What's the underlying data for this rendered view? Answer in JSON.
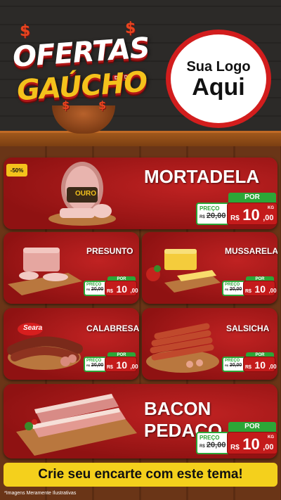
{
  "header": {
    "title_line1": "OFERTAS",
    "title_line2": "GAÚCHO",
    "title_tag": "DIA DO",
    "logo_line1": "Sua Logo",
    "logo_line2": "Aqui"
  },
  "featured": {
    "name": "MORTADELA",
    "badge": "-50%",
    "brand": "OURO",
    "price_label": "PREÇO",
    "old_prefix": "R$",
    "old_price": "20,00",
    "por_label": "POR",
    "currency": "R$",
    "price_int": "10",
    "price_dec": ",00",
    "unit": "KG"
  },
  "products": [
    {
      "name": "PRESUNTO",
      "price_label": "PREÇO",
      "old_prefix": "R$",
      "old_price": "20,00",
      "por_label": "POR",
      "currency": "R$",
      "price_int": "10",
      "price_dec": ",00"
    },
    {
      "name": "MUSSARELA",
      "price_label": "PREÇO",
      "old_prefix": "R$",
      "old_price": "20,00",
      "por_label": "POR",
      "currency": "R$",
      "price_int": "10",
      "price_dec": ",00"
    },
    {
      "name": "CALABRESA",
      "brand": "Seara",
      "price_label": "PREÇO",
      "old_prefix": "R$",
      "old_price": "20,00",
      "por_label": "POR",
      "currency": "R$",
      "price_int": "10",
      "price_dec": ",00"
    },
    {
      "name": "SALSICHA",
      "price_label": "PREÇO",
      "old_prefix": "R$",
      "old_price": "20,00",
      "por_label": "POR",
      "currency": "R$",
      "price_int": "10",
      "price_dec": ",00"
    }
  ],
  "bottom": {
    "name": "BACON PEDAÇO",
    "price_label": "PREÇO",
    "old_prefix": "R$",
    "old_price": "20,00",
    "por_label": "POR",
    "currency": "R$",
    "price_int": "10",
    "price_dec": ",00",
    "unit": "KG"
  },
  "cta": "Crie seu encarte com este tema!",
  "disclaimer": "*Imagens Meramente Ilustrativas",
  "colors": {
    "card_red": "#c02222",
    "price_green": "#2ca637",
    "cta_yellow": "#f4d01c",
    "title_yellow": "#f4c21c"
  },
  "icons": [
    "dollar-sign-icon",
    "leaf-icon"
  ]
}
